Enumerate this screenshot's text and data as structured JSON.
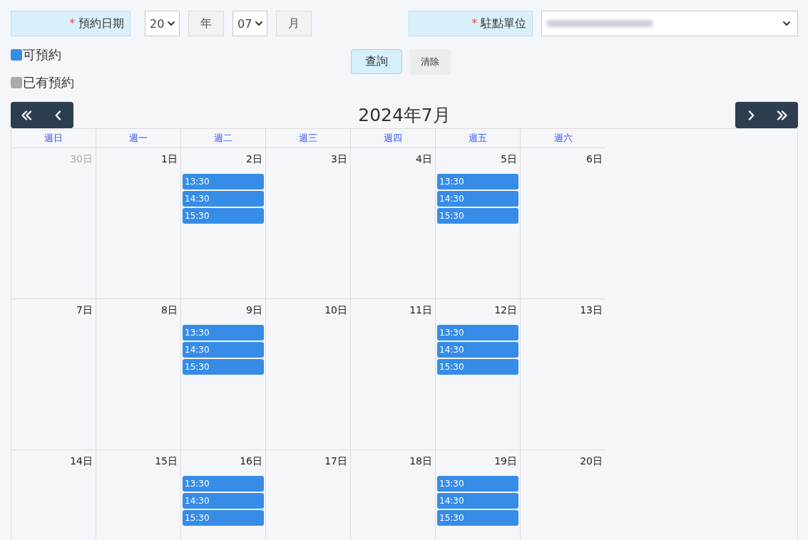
{
  "date_field": {
    "required_mark": "*",
    "label": "預約日期",
    "year": {
      "value": "20"
    },
    "year_unit": "年",
    "month": {
      "value": "07"
    },
    "month_unit": "月"
  },
  "unit_field": {
    "required_mark": "*",
    "label": "駐點單位"
  },
  "legend": [
    {
      "label": "可預約",
      "color": "#368ce7"
    },
    {
      "label": "已有預約",
      "color": "#aaaaaa"
    }
  ],
  "buttons": [
    {
      "label": "查詢",
      "kind": "primary"
    },
    {
      "label": "清除",
      "kind": "secondary"
    }
  ],
  "calendar": {
    "title": "2024年7月",
    "weekdays": [
      "週日",
      "週一",
      "週二",
      "週三",
      "週四",
      "週五",
      "週六"
    ],
    "weeks": [
      {
        "days": [
          {
            "day": "30日",
            "outside_month": true
          },
          {
            "day": "1日",
            "outside_month": false
          },
          {
            "day": "2日",
            "outside_month": false,
            "slots": [
              {
                "time": "13:30",
                "booked": false
              },
              {
                "time": "14:30",
                "booked": false
              },
              {
                "time": "15:30",
                "booked": false
              }
            ]
          },
          {
            "day": "3日",
            "outside_month": false
          },
          {
            "day": "4日",
            "outside_month": false
          },
          {
            "day": "5日",
            "outside_month": false,
            "slots": [
              {
                "time": "13:30",
                "booked": false
              },
              {
                "time": "14:30",
                "booked": false
              },
              {
                "time": "15:30",
                "booked": false
              }
            ]
          },
          {
            "day": "6日",
            "outside_month": false
          }
        ]
      },
      {
        "days": [
          {
            "day": "7日",
            "outside_month": false
          },
          {
            "day": "8日",
            "outside_month": false
          },
          {
            "day": "9日",
            "outside_month": false,
            "slots": [
              {
                "time": "13:30",
                "booked": false
              },
              {
                "time": "14:30",
                "booked": false
              },
              {
                "time": "15:30",
                "booked": false
              }
            ]
          },
          {
            "day": "10日",
            "outside_month": false
          },
          {
            "day": "11日",
            "outside_month": false
          },
          {
            "day": "12日",
            "outside_month": false,
            "slots": [
              {
                "time": "13:30",
                "booked": false
              },
              {
                "time": "14:30",
                "booked": false
              },
              {
                "time": "15:30",
                "booked": false
              }
            ]
          },
          {
            "day": "13日",
            "outside_month": false
          }
        ]
      },
      {
        "days": [
          {
            "day": "14日",
            "outside_month": false
          },
          {
            "day": "15日",
            "outside_month": false
          },
          {
            "day": "16日",
            "outside_month": false,
            "slots": [
              {
                "time": "13:30",
                "booked": false
              },
              {
                "time": "14:30",
                "booked": false
              },
              {
                "time": "15:30",
                "booked": false
              }
            ]
          },
          {
            "day": "17日",
            "outside_month": false
          },
          {
            "day": "18日",
            "outside_month": false
          },
          {
            "day": "19日",
            "outside_month": false,
            "slots": [
              {
                "time": "13:30",
                "booked": false
              },
              {
                "time": "14:30",
                "booked": false
              },
              {
                "time": "15:30",
                "booked": false
              }
            ]
          },
          {
            "day": "20日",
            "outside_month": false
          }
        ]
      }
    ]
  }
}
